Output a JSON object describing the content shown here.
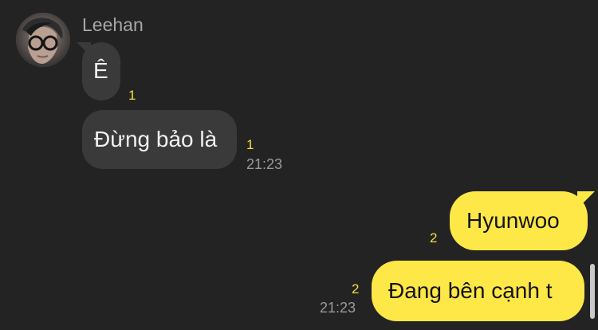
{
  "conversation": {
    "sender_name": "Leehan",
    "messages": [
      {
        "text": "Ê",
        "direction": "incoming",
        "unread_count": "1",
        "time": ""
      },
      {
        "text": "Đừng bảo là",
        "direction": "incoming",
        "unread_count": "1",
        "time": "21:23"
      },
      {
        "text": "Hyunwoo",
        "direction": "outgoing",
        "unread_count": "2",
        "time": ""
      },
      {
        "text": "Đang bên cạnh t",
        "direction": "outgoing",
        "unread_count": "2",
        "time": "21:23"
      }
    ]
  },
  "colors": {
    "background": "#232323",
    "incoming_bubble": "#3a3a3a",
    "outgoing_bubble": "#fde847",
    "unread_count": "#f4de44",
    "timestamp": "#9a9a9a"
  },
  "icons": {
    "avatar": "profile-photo"
  }
}
